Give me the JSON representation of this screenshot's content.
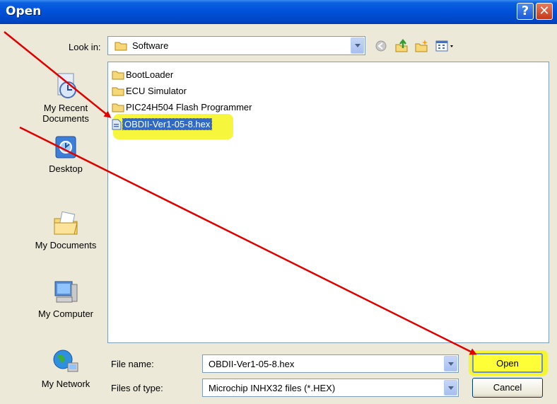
{
  "window": {
    "title": "Open",
    "help_glyph": "?",
    "close_glyph": "✕"
  },
  "lookin": {
    "label": "Look in:",
    "value": "Software"
  },
  "toolbar": {
    "icons": [
      "back-icon",
      "up-folder-icon",
      "new-folder-icon",
      "views-menu-icon"
    ]
  },
  "places": [
    {
      "label": "My Recent Documents",
      "line1": "My Recent",
      "line2": "Documents",
      "icon": "recent-documents-icon"
    },
    {
      "label": "Desktop",
      "icon": "desktop-icon"
    },
    {
      "label": "My Documents",
      "icon": "my-documents-icon"
    },
    {
      "label": "My Computer",
      "icon": "my-computer-icon"
    },
    {
      "label": "My Network",
      "icon": "my-network-icon"
    }
  ],
  "files": [
    {
      "name": "BootLoader",
      "type": "folder"
    },
    {
      "name": "ECU Simulator",
      "type": "folder"
    },
    {
      "name": "PIC24H504 Flash Programmer",
      "type": "folder"
    },
    {
      "name": "OBDII-Ver1-05-8.hex",
      "type": "file",
      "selected": true
    }
  ],
  "filename": {
    "label": "File name:",
    "value": "OBDII-Ver1-05-8.hex"
  },
  "filetype": {
    "label": "Files of type:",
    "value": "Microchip INHX32 files (*.HEX)"
  },
  "buttons": {
    "open": "Open",
    "cancel": "Cancel"
  },
  "colors": {
    "title_bar": "#0050d8",
    "dialog_bg": "#ece9d8",
    "highlight": "#f5f531",
    "annotation_arrow": "#e00000",
    "selection": "#316ac5"
  }
}
